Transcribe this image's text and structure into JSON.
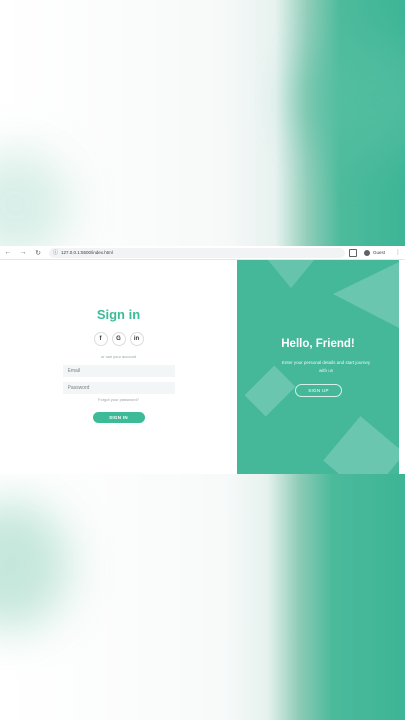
{
  "browser": {
    "url": "127.0.0.1:5500/index.html",
    "profile_name": "Guest"
  },
  "signin": {
    "title": "Sign in",
    "socials": [
      {
        "label": "f",
        "icon": "facebook-icon"
      },
      {
        "label": "G",
        "icon": "google-icon"
      },
      {
        "label": "in",
        "icon": "linkedin-icon"
      }
    ],
    "or_text": "or use your account",
    "email_placeholder": "Email",
    "password_placeholder": "Password",
    "forgot_text": "Forgot your password?",
    "button_label": "SIGN IN"
  },
  "overlay": {
    "title": "Hello, Friend!",
    "description": "Enter your personal details and start journey with us",
    "button_label": "SIGN UP"
  },
  "colors": {
    "accent": "#3dba97",
    "panel": "#45b89a"
  }
}
